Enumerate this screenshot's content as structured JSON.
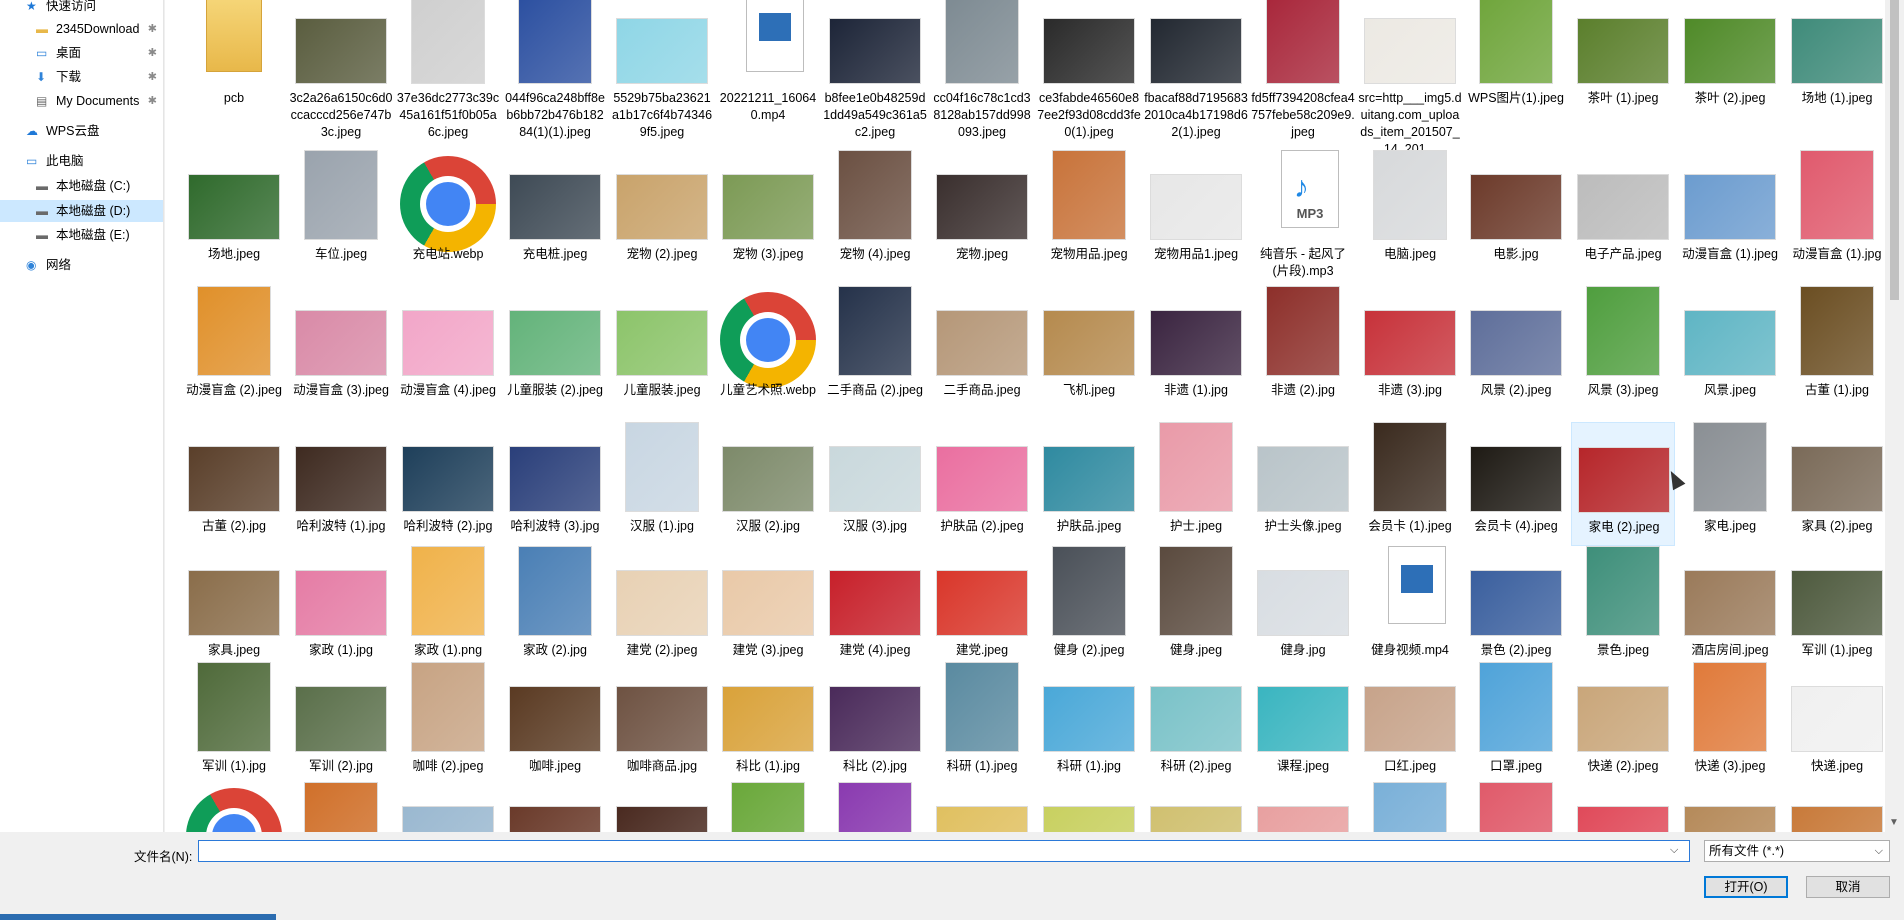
{
  "nav": {
    "items": [
      {
        "label": "快速访问",
        "icon": "star-icon",
        "pinned": false,
        "selected": false
      },
      {
        "label": "2345Download",
        "icon": "folder-icon",
        "pinned": true,
        "selected": false
      },
      {
        "label": "桌面",
        "icon": "desktop-icon",
        "pinned": true,
        "selected": false
      },
      {
        "label": "下载",
        "icon": "download-icon",
        "pinned": true,
        "selected": false
      },
      {
        "label": "My Documents",
        "icon": "documents-icon",
        "pinned": true,
        "selected": false
      },
      {
        "label": "WPS云盘",
        "icon": "cloud-icon",
        "pinned": false,
        "selected": false
      },
      {
        "label": "此电脑",
        "icon": "computer-icon",
        "pinned": false,
        "selected": false
      },
      {
        "label": "本地磁盘 (C:)",
        "icon": "drive-icon",
        "pinned": false,
        "selected": false
      },
      {
        "label": "本地磁盘 (D:)",
        "icon": "drive-icon",
        "pinned": false,
        "selected": true
      },
      {
        "label": "本地磁盘 (E:)",
        "icon": "drive-icon",
        "pinned": false,
        "selected": false
      },
      {
        "label": "网络",
        "icon": "network-icon",
        "pinned": false,
        "selected": false
      }
    ],
    "pin_glyph": "✱"
  },
  "files": [
    {
      "name": "pcb",
      "kind": "folder",
      "color": "#e8b84a"
    },
    {
      "name": "3c2a26a6150c6d0ccacccd256e747b3c.jpeg",
      "kind": "image",
      "color": "#5a5d3f"
    },
    {
      "name": "37e36dc2773c39c45a161f51f0b05a6c.jpeg",
      "kind": "image",
      "color": "#cfcfcf"
    },
    {
      "name": "044f96ca248bff8eb6bb72b476b18284(1)(1).jpeg",
      "kind": "image",
      "color": "#2b4fa0"
    },
    {
      "name": "5529b75ba23621a1b17c6f4b743469f5.jpeg",
      "kind": "image",
      "color": "#8fd6e6"
    },
    {
      "name": "20221211_160640.mp4",
      "kind": "video",
      "color": "#2d6fb7"
    },
    {
      "name": "b8fee1e0b48259d1dd49a549c361a5c2.jpeg",
      "kind": "image",
      "color": "#1d2538"
    },
    {
      "name": "cc04f16c78c1cd38128ab157dd998093.jpeg",
      "kind": "image",
      "color": "#7d8a92"
    },
    {
      "name": "ce3fabde46560e87ee2f93d08cdd3fe0(1).jpeg",
      "kind": "image",
      "color": "#2a2a2a"
    },
    {
      "name": "fbacaf88d71956832010ca4b17198d62(1).jpeg",
      "kind": "image",
      "color": "#222831"
    },
    {
      "name": "fd5ff7394208cfea4757febe58c209e9.jpeg",
      "kind": "image",
      "color": "#a8263a"
    },
    {
      "name": "src=http___img5.duitang.com_uploads_item_201507_14_201...",
      "kind": "image",
      "color": "#ece9e3"
    },
    {
      "name": "WPS图片(1).jpeg",
      "kind": "image",
      "color": "#6fa53b"
    },
    {
      "name": "茶叶 (1).jpeg",
      "kind": "image",
      "color": "#5b7f2c"
    },
    {
      "name": "茶叶 (2).jpeg",
      "kind": "image",
      "color": "#4f8a28"
    },
    {
      "name": "场地 (1).jpeg",
      "kind": "image",
      "color": "#3f8b7a"
    },
    {
      "name": "场地.jpeg",
      "kind": "image",
      "color": "#2f6a2c"
    },
    {
      "name": "车位.jpeg",
      "kind": "image",
      "color": "#9aa3ad"
    },
    {
      "name": "充电站.webp",
      "kind": "chrome",
      "color": "#4285f4"
    },
    {
      "name": "充电桩.jpeg",
      "kind": "image",
      "color": "#3e4a55"
    },
    {
      "name": "宠物 (2).jpeg",
      "kind": "image",
      "color": "#c9a36b"
    },
    {
      "name": "宠物 (3).jpeg",
      "kind": "image",
      "color": "#7c9a55"
    },
    {
      "name": "宠物 (4).jpeg",
      "kind": "image",
      "color": "#6b5042"
    },
    {
      "name": "宠物.jpeg",
      "kind": "image",
      "color": "#3a2f2e"
    },
    {
      "name": "宠物用品.jpeg",
      "kind": "image",
      "color": "#c8733a"
    },
    {
      "name": "宠物用品1.jpeg",
      "kind": "image",
      "color": "#e7e7e7"
    },
    {
      "name": "纯音乐 - 起风了 (片段).mp3",
      "kind": "audio",
      "color": "#1e88e5"
    },
    {
      "name": "电脑.jpeg",
      "kind": "image",
      "color": "#d7d9db"
    },
    {
      "name": "电影.jpg",
      "kind": "image",
      "color": "#6c3a2a"
    },
    {
      "name": "电子产品.jpeg",
      "kind": "image",
      "color": "#bcbcbc"
    },
    {
      "name": "动漫盲盒 (1).jpeg",
      "kind": "image",
      "color": "#6c9ccf"
    },
    {
      "name": "动漫盲盒 (1).jpg",
      "kind": "image",
      "color": "#e05a6d"
    },
    {
      "name": "动漫盲盒 (2).jpeg",
      "kind": "image",
      "color": "#e0902a"
    },
    {
      "name": "动漫盲盒 (3).jpeg",
      "kind": "image",
      "color": "#d98aa7"
    },
    {
      "name": "动漫盲盒 (4).jpeg",
      "kind": "image",
      "color": "#f2a6c8"
    },
    {
      "name": "儿童服装 (2).jpeg",
      "kind": "image",
      "color": "#63b37a"
    },
    {
      "name": "儿童服装.jpeg",
      "kind": "image",
      "color": "#8cc46a"
    },
    {
      "name": "儿童艺术照.webp",
      "kind": "chrome",
      "color": "#4285f4"
    },
    {
      "name": "二手商品 (2).jpeg",
      "kind": "image",
      "color": "#25324a"
    },
    {
      "name": "二手商品.jpeg",
      "kind": "image",
      "color": "#b59778"
    },
    {
      "name": "飞机.jpeg",
      "kind": "image",
      "color": "#b58a4e"
    },
    {
      "name": "非遗 (1).jpg",
      "kind": "image",
      "color": "#3a2440"
    },
    {
      "name": "非遗 (2).jpg",
      "kind": "image",
      "color": "#8d2f2a"
    },
    {
      "name": "非遗 (3).jpg",
      "kind": "image",
      "color": "#c7323a"
    },
    {
      "name": "风景 (2).jpeg",
      "kind": "image",
      "color": "#5e6e9a"
    },
    {
      "name": "风景 (3).jpeg",
      "kind": "image",
      "color": "#4f9e3e"
    },
    {
      "name": "风景.jpeg",
      "kind": "image",
      "color": "#5fb5c4"
    },
    {
      "name": "古董 (1).jpg",
      "kind": "image",
      "color": "#6b4e22"
    },
    {
      "name": "古董 (2).jpg",
      "kind": "image",
      "color": "#5a3f2a"
    },
    {
      "name": "哈利波特 (1).jpg",
      "kind": "image",
      "color": "#3e2a20"
    },
    {
      "name": "哈利波特 (2).jpg",
      "kind": "image",
      "color": "#1e3f5a"
    },
    {
      "name": "哈利波特 (3).jpg",
      "kind": "image",
      "color": "#2a3f7a"
    },
    {
      "name": "汉服 (1).jpg",
      "kind": "image",
      "color": "#c8d6e2"
    },
    {
      "name": "汉服 (2).jpg",
      "kind": "image",
      "color": "#7d8a6a"
    },
    {
      "name": "汉服 (3).jpg",
      "kind": "image",
      "color": "#c9d8dc"
    },
    {
      "name": "护肤品 (2).jpeg",
      "kind": "image",
      "color": "#ea6fa0"
    },
    {
      "name": "护肤品.jpeg",
      "kind": "image",
      "color": "#2f8aa0"
    },
    {
      "name": "护士.jpeg",
      "kind": "image",
      "color": "#e99aa8"
    },
    {
      "name": "护士头像.jpeg",
      "kind": "image",
      "color": "#b9c4c9"
    },
    {
      "name": "会员卡 (1).jpeg",
      "kind": "image",
      "color": "#3a2a1e"
    },
    {
      "name": "会员卡 (4).jpeg",
      "kind": "image",
      "color": "#1e1a14"
    },
    {
      "name": "家电 (2).jpeg",
      "kind": "image",
      "color": "#b6262a",
      "selected": true
    },
    {
      "name": "家电.jpeg",
      "kind": "image",
      "color": "#8a8f94"
    },
    {
      "name": "家具 (2).jpeg",
      "kind": "image",
      "color": "#7a6a58"
    },
    {
      "name": "家具.jpeg",
      "kind": "image",
      "color": "#8a6d4a"
    },
    {
      "name": "家政 (1).jpg",
      "kind": "image",
      "color": "#e57ca5"
    },
    {
      "name": "家政 (1).png",
      "kind": "image",
      "color": "#f0b24a"
    },
    {
      "name": "家政 (2).jpg",
      "kind": "image",
      "color": "#4a7fb5"
    },
    {
      "name": "建党 (2).jpeg",
      "kind": "image",
      "color": "#e8d1b4"
    },
    {
      "name": "建党 (3).jpeg",
      "kind": "image",
      "color": "#e9c9a8"
    },
    {
      "name": "建党 (4).jpeg",
      "kind": "image",
      "color": "#c7202a"
    },
    {
      "name": "建党.jpeg",
      "kind": "image",
      "color": "#d9362a"
    },
    {
      "name": "健身 (2).jpeg",
      "kind": "image",
      "color": "#4a5058"
    },
    {
      "name": "健身.jpeg",
      "kind": "image",
      "color": "#5a4a3e"
    },
    {
      "name": "健身.jpg",
      "kind": "image",
      "color": "#d8dde2"
    },
    {
      "name": "健身视频.mp4",
      "kind": "video",
      "color": "#2d6fb7"
    },
    {
      "name": "景色 (2).jpeg",
      "kind": "image",
      "color": "#3a5f9e"
    },
    {
      "name": "景色.jpeg",
      "kind": "image",
      "color": "#3e8f7a"
    },
    {
      "name": "酒店房间.jpeg",
      "kind": "image",
      "color": "#9a7a5a"
    },
    {
      "name": "军训 (1).jpeg",
      "kind": "image",
      "color": "#4e5a3e"
    },
    {
      "name": "军训 (1).jpg",
      "kind": "image",
      "color": "#4f6a3a"
    },
    {
      "name": "军训 (2).jpg",
      "kind": "image",
      "color": "#5a6f4a"
    },
    {
      "name": "咖啡 (2).jpeg",
      "kind": "image",
      "color": "#c7a383"
    },
    {
      "name": "咖啡.jpeg",
      "kind": "image",
      "color": "#5a3a22"
    },
    {
      "name": "咖啡商品.jpg",
      "kind": "image",
      "color": "#6e5242"
    },
    {
      "name": "科比 (1).jpg",
      "kind": "image",
      "color": "#d9a23a"
    },
    {
      "name": "科比 (2).jpg",
      "kind": "image",
      "color": "#4a2a5a"
    },
    {
      "name": "科研 (1).jpeg",
      "kind": "image",
      "color": "#5a8aa0"
    },
    {
      "name": "科研 (1).jpg",
      "kind": "image",
      "color": "#4aa8d8"
    },
    {
      "name": "科研 (2).jpeg",
      "kind": "image",
      "color": "#7ac2c8"
    },
    {
      "name": "课程.jpeg",
      "kind": "image",
      "color": "#3ab5c0"
    },
    {
      "name": "口红.jpeg",
      "kind": "image",
      "color": "#c7a38a"
    },
    {
      "name": "口罩.jpeg",
      "kind": "image",
      "color": "#4fa3d9"
    },
    {
      "name": "快递 (2).jpeg",
      "kind": "image",
      "color": "#c9a67a"
    },
    {
      "name": "快递 (3).jpeg",
      "kind": "image",
      "color": "#e07a3a"
    },
    {
      "name": "快递.jpeg",
      "kind": "image",
      "color": "#f0f0f0"
    },
    {
      "name": "",
      "kind": "chrome",
      "color": "#4285f4"
    },
    {
      "name": "",
      "kind": "image",
      "color": "#d0702a"
    },
    {
      "name": "",
      "kind": "image",
      "color": "#9ab8d0"
    },
    {
      "name": "",
      "kind": "image",
      "color": "#6a3a2a"
    },
    {
      "name": "",
      "kind": "image",
      "color": "#4a2a20"
    },
    {
      "name": "",
      "kind": "image",
      "color": "#6aa83a"
    },
    {
      "name": "",
      "kind": "image",
      "color": "#8a3ab0"
    },
    {
      "name": "",
      "kind": "image",
      "color": "#e0c060"
    },
    {
      "name": "",
      "kind": "image",
      "color": "#c8d060"
    },
    {
      "name": "",
      "kind": "image",
      "color": "#d0c070"
    },
    {
      "name": "",
      "kind": "image",
      "color": "#e8a0a0"
    },
    {
      "name": "",
      "kind": "image",
      "color": "#7ab0d8"
    },
    {
      "name": "",
      "kind": "image",
      "color": "#e05a6a"
    },
    {
      "name": "",
      "kind": "image",
      "color": "#e04a5a"
    },
    {
      "name": "",
      "kind": "image",
      "color": "#b58a5a"
    },
    {
      "name": "",
      "kind": "image",
      "color": "#c87a3a"
    }
  ],
  "audio_tag": "MP3",
  "bottom": {
    "filename_label": "文件名(N):",
    "filename_value": "",
    "filetype_value": "所有文件 (*.*)",
    "open_label": "打开(O)",
    "cancel_label": "取消"
  },
  "colors": {
    "accent": "#0078d7",
    "selection": "#cce8ff"
  }
}
